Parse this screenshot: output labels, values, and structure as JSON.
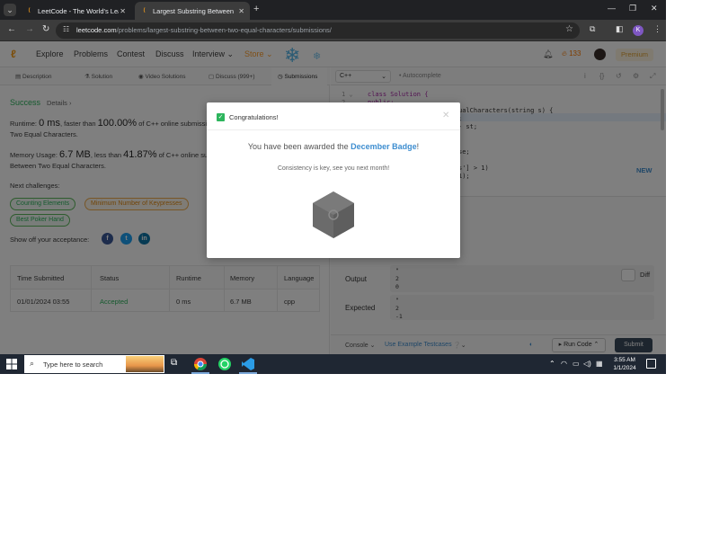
{
  "browser": {
    "tabs": [
      {
        "label": "LeetCode - The World's Leadin"
      },
      {
        "label": "Largest Substring Between Two"
      }
    ],
    "url_host": "leetcode.com",
    "url_path": "/problems/largest-substring-between-two-equal-characters/submissions/",
    "profile_initial": "K"
  },
  "header": {
    "nav": [
      "Explore",
      "Problems",
      "Contest",
      "Discuss",
      "Interview",
      "Store"
    ],
    "streak": "133",
    "premium": "Premium"
  },
  "left_tabs": [
    "Description",
    "Solution",
    "Video Solutions",
    "Discuss (999+)",
    "Submissions"
  ],
  "result": {
    "status": "Success",
    "details": "Details",
    "runtime_prefix": "Runtime:",
    "runtime_value": "0 ms",
    "runtime_mid": ", faster than",
    "runtime_pct": "100.00%",
    "runtime_suffix": "of C++ online submissi",
    "runtime_line2": "Two Equal Characters.",
    "memory_prefix": "Memory Usage:",
    "memory_value": "6.7 MB",
    "memory_mid": ", less than",
    "memory_pct": "41.87%",
    "memory_suffix": "of C++ online sub",
    "memory_line2": "Between Two Equal Characters.",
    "next_label": "Next challenges:",
    "challenges": [
      "Counting Elements",
      "Minimum Number of Keypresses",
      "Best Poker Hand"
    ],
    "show_off": "Show off your acceptance:"
  },
  "table": {
    "headers": [
      "Time Submitted",
      "Status",
      "Runtime",
      "Memory",
      "Language"
    ],
    "row": [
      "01/01/2024 03:55",
      "Accepted",
      "0 ms",
      "6.7 MB",
      "cpp"
    ]
  },
  "editor": {
    "language": "C++",
    "autocomplete": "Autocomplete",
    "lines": [
      "class Solution {",
      "public:",
      "ualCharacters(string s) {",
      ";",
      "- st;",
      "",
      "",
      "se;",
      "",
      "s'] > 1)",
      "1);"
    ],
    "new_badge": "NEW"
  },
  "console": {
    "output_label": "Output",
    "output_values": "\"\n2\n0",
    "expected_label": "Expected",
    "expected_values": "\"\n2\n-1",
    "diff": "Diff",
    "console_btn": "Console",
    "example_btn": "Use Example Testcases",
    "run_btn": "Run Code",
    "submit_btn": "Submit"
  },
  "modal": {
    "title": "Congratulations!",
    "award_prefix": "You have been awarded the",
    "award_badge": "December Badge",
    "award_suffix": "!",
    "subtitle": "Consistency is key, see you next month!"
  },
  "taskbar": {
    "search_placeholder": "Type here to search",
    "time": "3:55 AM",
    "date": "1/1/2024"
  },
  "colors": {
    "accent_green": "#2db55d",
    "accent_orange": "#f89f1b",
    "link_blue": "#3e8ed0"
  }
}
